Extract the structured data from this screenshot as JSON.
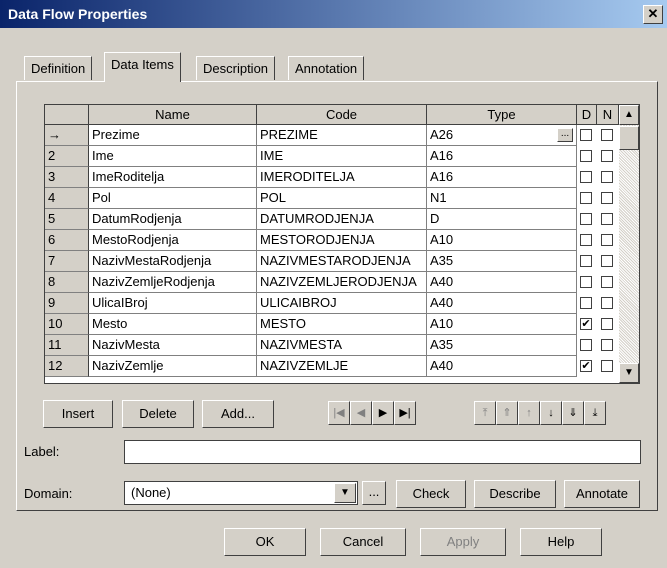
{
  "window": {
    "title": "Data Flow Properties",
    "close_glyph": "✕"
  },
  "tabs": [
    {
      "label": "Definition"
    },
    {
      "label": "Data Items"
    },
    {
      "label": "Description"
    },
    {
      "label": "Annotation"
    }
  ],
  "grid": {
    "columns": {
      "name": "Name",
      "code": "Code",
      "type": "Type",
      "d": "D",
      "n": "N"
    },
    "rows": [
      {
        "num": "→",
        "name": "Prezime",
        "code": "PREZIME",
        "type": "A26",
        "d": false,
        "n": false
      },
      {
        "num": "2",
        "name": "Ime",
        "code": "IME",
        "type": "A16",
        "d": false,
        "n": false
      },
      {
        "num": "3",
        "name": "ImeRoditelja",
        "code": "IMERODITELJA",
        "type": "A16",
        "d": false,
        "n": false
      },
      {
        "num": "4",
        "name": "Pol",
        "code": "POL",
        "type": "N1",
        "d": false,
        "n": false
      },
      {
        "num": "5",
        "name": "DatumRodjenja",
        "code": "DATUMRODJENJA",
        "type": "D",
        "d": false,
        "n": false
      },
      {
        "num": "6",
        "name": "MestoRodjenja",
        "code": "MESTORODJENJA",
        "type": "A10",
        "d": false,
        "n": false
      },
      {
        "num": "7",
        "name": "NazivMestaRodjenja",
        "code": "NAZIVMESTARODJENJA",
        "type": "A35",
        "d": false,
        "n": false
      },
      {
        "num": "8",
        "name": "NazivZemljeRodjenja",
        "code": "NAZIVZEMLJERODJENJA",
        "type": "A40",
        "d": false,
        "n": false
      },
      {
        "num": "9",
        "name": "UlicaIBroj",
        "code": "ULICAIBROJ",
        "type": "A40",
        "d": false,
        "n": false
      },
      {
        "num": "10",
        "name": "Mesto",
        "code": "MESTO",
        "type": "A10",
        "d": true,
        "n": false
      },
      {
        "num": "11",
        "name": "NazivMesta",
        "code": "NAZIVMESTA",
        "type": "A35",
        "d": false,
        "n": false
      },
      {
        "num": "12",
        "name": "NazivZemlje",
        "code": "NAZIVZEMLJE",
        "type": "A40",
        "d": true,
        "n": false
      }
    ],
    "ellipsis": "...",
    "checkmark": "✔",
    "scroll_up": "▲",
    "scroll_down": "▼"
  },
  "buttons": {
    "insert": "Insert",
    "delete": "Delete",
    "add": "Add..."
  },
  "nav_icons": {
    "first": "|◀",
    "prev": "◀",
    "next": "▶",
    "last": "▶|"
  },
  "move_icons": {
    "top": "⤒",
    "up_fast": "⇑",
    "up": "↑",
    "down": "↓",
    "down_fast": "⇓",
    "bottom": "⤓"
  },
  "label": {
    "caption": "Label:",
    "value": ""
  },
  "domain": {
    "caption": "Domain:",
    "value": "(None)",
    "dropdown": "▼",
    "browse": "...",
    "check": "Check",
    "describe": "Describe",
    "annotate": "Annotate"
  },
  "footer": {
    "ok": "OK",
    "cancel": "Cancel",
    "apply": "Apply",
    "help": "Help"
  }
}
